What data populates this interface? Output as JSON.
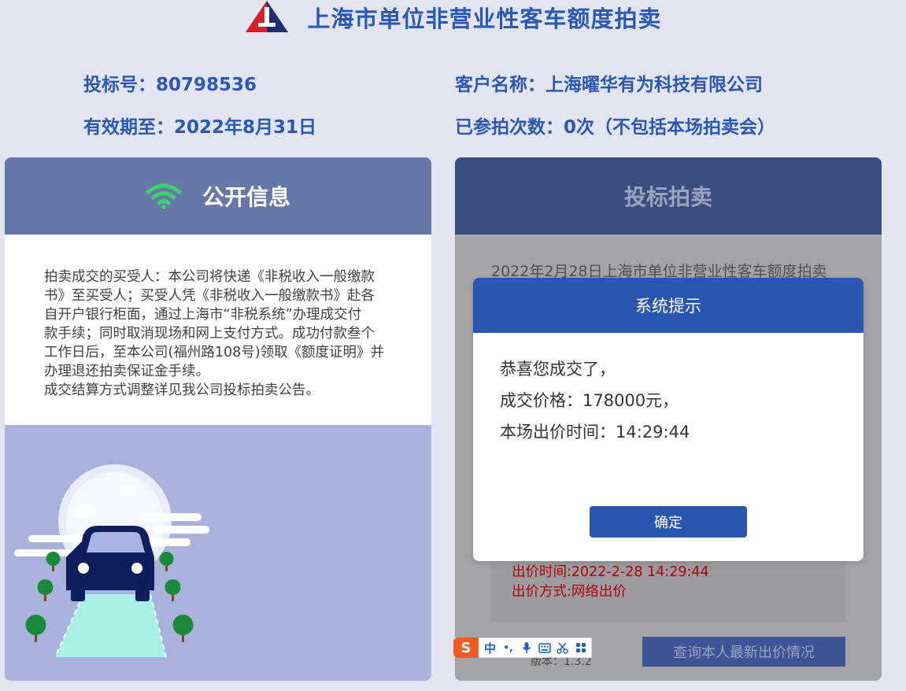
{
  "header": {
    "title": "上海市单位非营业性客车额度拍卖"
  },
  "info": {
    "bid_label": "投标号：",
    "bid_number": "80798536",
    "customer_label": "客户名称：",
    "customer_name": "上海曜华有为科技有限公司",
    "valid_label": "有效期至：",
    "valid_date": "2022年8月31日",
    "attended_label": "已参拍次数：",
    "attended_value": "0次（不包括本场拍卖会）"
  },
  "public_info": {
    "title": "公开信息",
    "notice_lines": [
      "拍卖成交的买受人：本公司将快递《非税收入一般缴款",
      "书》至买受人；买受人凭《非税收入一般缴款书》赴各",
      "自开户银行柜面，通过上海市“非税系统”办理成交付",
      "款手续；同时取消现场和网上支付方式。成功付款叁个",
      "工作日后，至本公司(福州路108号)领取《额度证明》并",
      "办理退还拍卖保证金手续。",
      "成交结算方式调整详见我公司投标拍卖公告。"
    ]
  },
  "bidding": {
    "title": "投标拍卖",
    "session_line": "2022年2月28日上海市单位非营业性客车额度拍卖",
    "bid_time_line": "出价时间:2022-2-28 14:29:44",
    "bid_method_line": "出价方式:网络出价",
    "query_button": "查询本人最新出价情况",
    "version": "版本：1.3.2"
  },
  "modal": {
    "title": "系统提示",
    "line1": "恭喜您成交了，",
    "line2": "成交价格：178000元，",
    "line3": "本场出价时间：14:29:44",
    "confirm": "确定"
  },
  "ime": {
    "logo": "S",
    "mode": "中",
    "punct": "•,",
    "icons": [
      "microphone-icon",
      "keyboard-icon",
      "scissors-icon",
      "grid-icon"
    ]
  },
  "colors": {
    "accent": "#2a56b1",
    "title_blue": "#2b57b6",
    "page_bg": "#e2e5f1",
    "alert_red": "#b00000"
  }
}
